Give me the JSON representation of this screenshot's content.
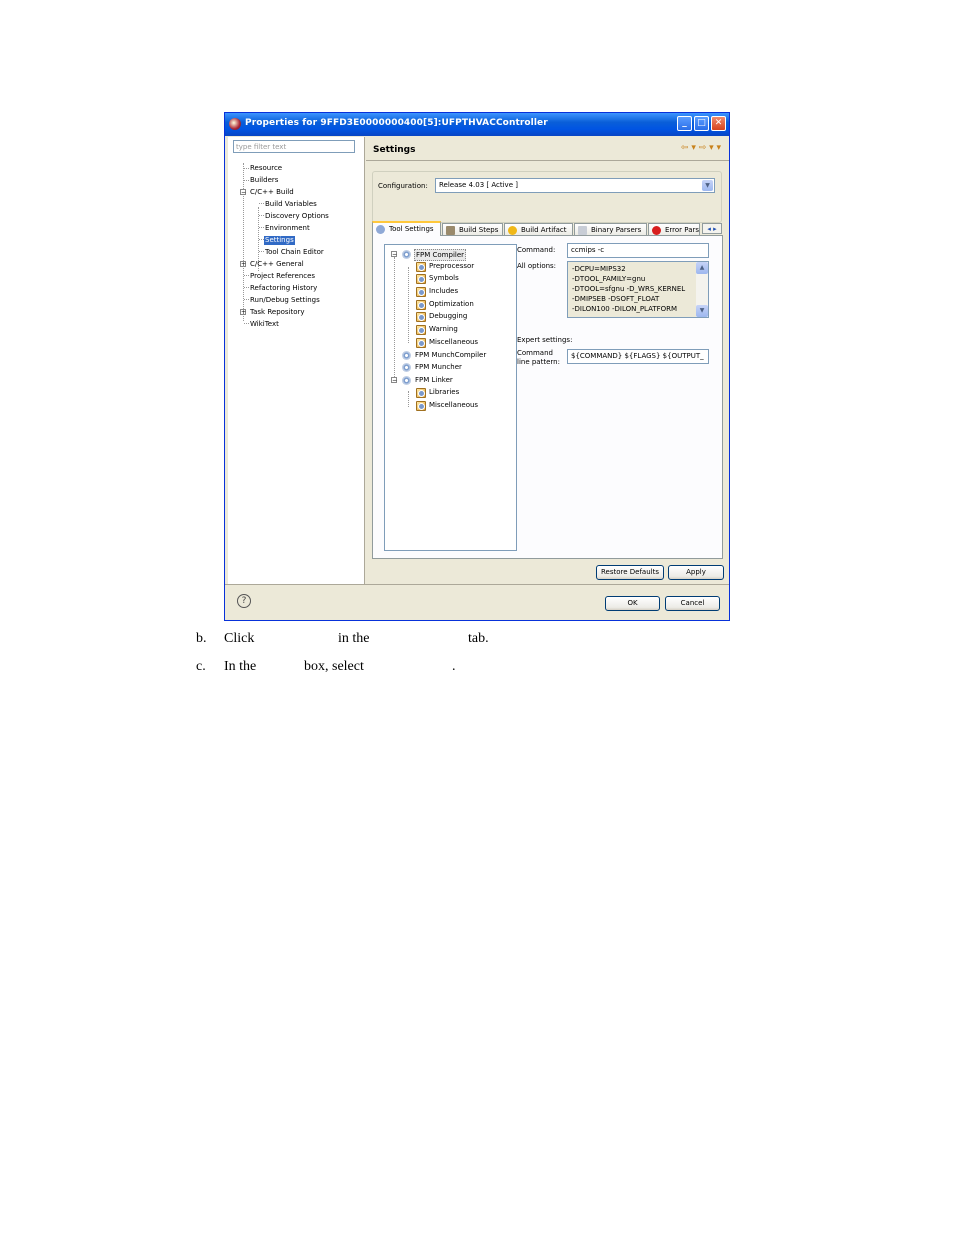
{
  "window": {
    "title": "Properties for 9FFD3E0000000400[5]:UFPTHVACController",
    "buttons": {
      "minimize": "_",
      "maximize": "□",
      "close": "✕"
    }
  },
  "sidebar": {
    "filter_placeholder": "type filter text",
    "items": [
      {
        "label": "Resource"
      },
      {
        "label": "Builders"
      },
      {
        "label": "C/C++ Build"
      },
      {
        "label": "Build Variables"
      },
      {
        "label": "Discovery Options"
      },
      {
        "label": "Environment"
      },
      {
        "label": "Settings"
      },
      {
        "label": "Tool Chain Editor"
      },
      {
        "label": "C/C++ General"
      },
      {
        "label": "Project References"
      },
      {
        "label": "Refactoring History"
      },
      {
        "label": "Run/Debug Settings"
      },
      {
        "label": "Task Repository"
      },
      {
        "label": "WikiText"
      }
    ]
  },
  "header": {
    "title": "Settings",
    "nav": "⇦ ▾ ⇨ ▾ ▾"
  },
  "configuration": {
    "label": "Configuration:",
    "value": "Release 4.03  [ Active ]"
  },
  "tabs": [
    "Tool Settings",
    "Build Steps",
    "Build Artifact",
    "Binary Parsers",
    "Error Parsers"
  ],
  "tools_tree": [
    {
      "label": "FPM Compiler"
    },
    {
      "label": "Preprocessor"
    },
    {
      "label": "Symbols"
    },
    {
      "label": "Includes"
    },
    {
      "label": "Optimization"
    },
    {
      "label": "Debugging"
    },
    {
      "label": "Warning"
    },
    {
      "label": "Miscellaneous"
    },
    {
      "label": "FPM MunchCompiler"
    },
    {
      "label": "FPM Muncher"
    },
    {
      "label": "FPM Linker"
    },
    {
      "label": "Libraries"
    },
    {
      "label": "Miscellaneous"
    }
  ],
  "tool_form": {
    "command_label": "Command:",
    "command_value": "ccmips -c",
    "all_options_label": "All options:",
    "options": [
      "-DCPU=MIPS32",
      "-DTOOL_FAMILY=gnu",
      "-DTOOL=sfgnu -D_WRS_KERNEL",
      "-DMIPSEB -DSOFT_FLOAT",
      "-DILON100 -DILON_PLATFORM"
    ],
    "expert_label": "Expert settings:",
    "pattern_label_1": "Command",
    "pattern_label_2": "line pattern:",
    "pattern_value": "${COMMAND} ${FLAGS} ${OUTPUT_"
  },
  "buttons": {
    "restore_defaults": "Restore Defaults",
    "apply": "Apply",
    "ok": "OK",
    "cancel": "Cancel",
    "help": "?"
  },
  "doc": {
    "step_b_marker": "b.",
    "step_b_parts": [
      "Click",
      "in the",
      "tab."
    ],
    "step_c_marker": "c.",
    "step_c_parts": [
      "In the",
      "box, select",
      "."
    ]
  }
}
